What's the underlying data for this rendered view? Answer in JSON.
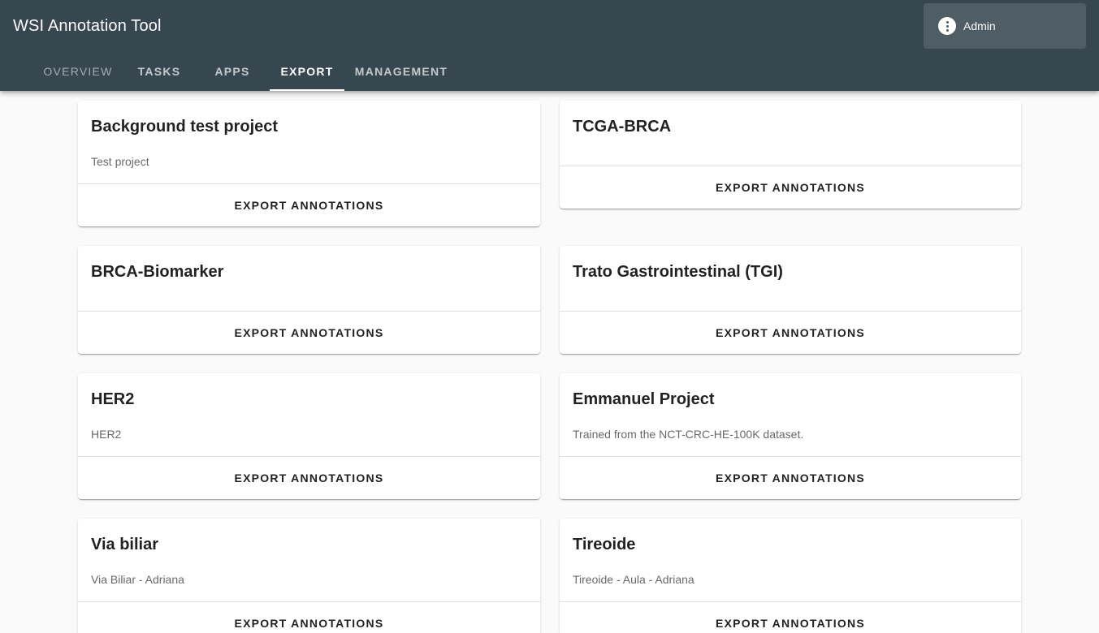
{
  "app": {
    "title": "WSI Annotation Tool",
    "user_name": "Admin",
    "user_icon": "more-vert-icon"
  },
  "tabs": [
    {
      "label": "OVERVIEW"
    },
    {
      "label": "TASKS"
    },
    {
      "label": "APPS"
    },
    {
      "label": "EXPORT",
      "active": true
    },
    {
      "label": "MANAGEMENT"
    }
  ],
  "projects": [
    {
      "name": "Background test project",
      "description": "Test project",
      "action": "EXPORT ANNOTATIONS"
    },
    {
      "name": "TCGA-BRCA",
      "description": "",
      "action": "EXPORT ANNOTATIONS"
    },
    {
      "name": "BRCA-Biomarker",
      "description": "",
      "action": "EXPORT ANNOTATIONS"
    },
    {
      "name": "Trato Gastrointestinal (TGI)",
      "description": "",
      "action": "EXPORT ANNOTATIONS"
    },
    {
      "name": "HER2",
      "description": "HER2",
      "action": "EXPORT ANNOTATIONS"
    },
    {
      "name": "Emmanuel Project",
      "description": "Trained from the NCT-CRC-HE-100K dataset.",
      "action": "EXPORT ANNOTATIONS"
    },
    {
      "name": "Via biliar",
      "description": "Via Biliar - Adriana",
      "action": "EXPORT ANNOTATIONS"
    },
    {
      "name": "Tireoide",
      "description": "Tireoide - Aula - Adriana",
      "action": "EXPORT ANNOTATIONS"
    }
  ],
  "colors": {
    "appbar": "#37474f",
    "user_button": "#4f5d64",
    "background": "#fafafa"
  }
}
